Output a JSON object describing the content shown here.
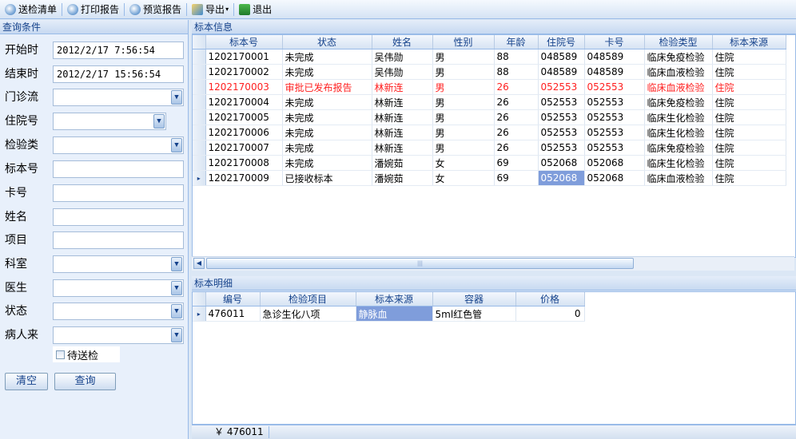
{
  "toolbar": {
    "items": [
      {
        "label": "送检清单",
        "icon": "list-icon"
      },
      {
        "label": "打印报告",
        "icon": "print-icon"
      },
      {
        "label": "预览报告",
        "icon": "preview-icon"
      },
      {
        "label": "导出",
        "icon": "export-icon",
        "dropdown_arrow": "▾"
      },
      {
        "label": "退出",
        "icon": "exit-icon"
      }
    ]
  },
  "query": {
    "title": "查询条件",
    "start_label": "开始时",
    "start_value": "2012/2/17 7:56:54",
    "end_label": "结束时",
    "end_value": "2012/2/17 15:56:54",
    "outpatient_label": "门诊流",
    "inpatient_label": "住院号",
    "test_type_label": "检验类",
    "specimen_no_label": "标本号",
    "card_label": "卡号",
    "name_label": "姓名",
    "item_label": "项目",
    "dept_label": "科室",
    "doctor_label": "医生",
    "status_label": "状态",
    "patient_source_label": "病人来",
    "pending_label": "待送检",
    "clear_label": "清空",
    "search_label": "查询"
  },
  "specimen": {
    "title": "标本信息",
    "columns": [
      "标本号",
      "状态",
      "姓名",
      "性别",
      "年龄",
      "住院号",
      "卡号",
      "检验类型",
      "标本来源"
    ],
    "rows": [
      [
        "1202170001",
        "未完成",
        "吴伟勋",
        "男",
        "88",
        "048589",
        "048589",
        "临床免疫检验",
        "住院"
      ],
      [
        "1202170002",
        "未完成",
        "吴伟勋",
        "男",
        "88",
        "048589",
        "048589",
        "临床血液检验",
        "住院"
      ],
      [
        "1202170003",
        "审批已发布报告",
        "林新连",
        "男",
        "26",
        "052553",
        "052553",
        "临床血液检验",
        "住院"
      ],
      [
        "1202170004",
        "未完成",
        "林新连",
        "男",
        "26",
        "052553",
        "052553",
        "临床免疫检验",
        "住院"
      ],
      [
        "1202170005",
        "未完成",
        "林新连",
        "男",
        "26",
        "052553",
        "052553",
        "临床生化检验",
        "住院"
      ],
      [
        "1202170006",
        "未完成",
        "林新连",
        "男",
        "26",
        "052553",
        "052553",
        "临床生化检验",
        "住院"
      ],
      [
        "1202170007",
        "未完成",
        "林新连",
        "男",
        "26",
        "052553",
        "052553",
        "临床免疫检验",
        "住院"
      ],
      [
        "1202170008",
        "未完成",
        "潘婉茹",
        "女",
        "69",
        "052068",
        "052068",
        "临床生化检验",
        "住院"
      ],
      [
        "1202170009",
        "已接收标本",
        "潘婉茹",
        "女",
        "69",
        "052068",
        "052068",
        "临床血液检验",
        "住院"
      ]
    ],
    "highlight_row": 2,
    "highlight_color": "#ff2020",
    "current_row": 8,
    "row_indicator": "▸"
  },
  "detail": {
    "title": "标本明细",
    "columns": [
      "编号",
      "检验项目",
      "标本来源",
      "容器",
      "价格"
    ],
    "rows": [
      [
        "476011",
        "急诊生化八项",
        "静脉血",
        "5ml红色管",
        "0"
      ]
    ],
    "row_indicator": "▸"
  },
  "statusbar": {
    "text": "￥ 476011"
  },
  "colors": {
    "selection": "#7f9ddb",
    "header_text": "#15428b"
  }
}
